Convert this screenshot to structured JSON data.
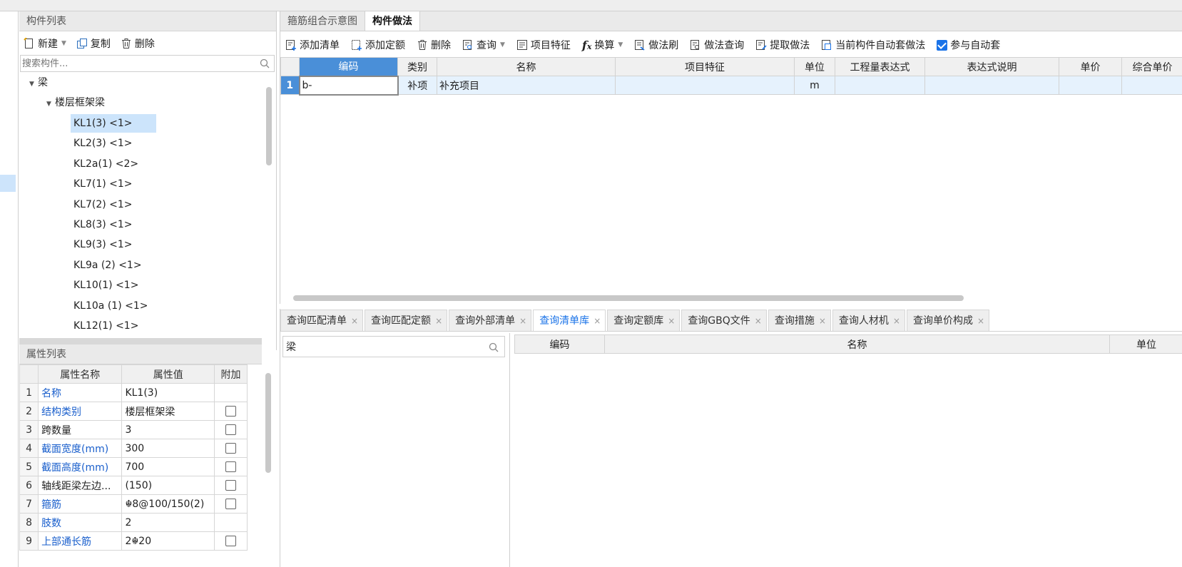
{
  "component_list": {
    "title": "构件列表",
    "toolbar": {
      "new_label": "新建",
      "copy_label": "复制",
      "delete_label": "删除"
    },
    "search_placeholder": "搜索构件...",
    "tree": {
      "root": "梁",
      "group": "楼层框架梁",
      "items": [
        "KL1(3) <1>",
        "KL2(3) <1>",
        "KL2a(1) <2>",
        "KL7(1) <1>",
        "KL7(2) <1>",
        "KL8(3) <1>",
        "KL9(3) <1>",
        "KL9a (2)  <1>",
        "KL10(1) <1>",
        "KL10a (1)  <1>",
        "KL12(1) <1>"
      ]
    }
  },
  "property_list": {
    "title": "属性列表",
    "headers": [
      "属性名称",
      "属性值",
      "附加"
    ],
    "rows": [
      {
        "idx": "1",
        "name": "名称",
        "value": "KL1(3)"
      },
      {
        "idx": "2",
        "name": "结构类别",
        "value": "楼层框架梁"
      },
      {
        "idx": "3",
        "name": "跨数量",
        "value": "3"
      },
      {
        "idx": "4",
        "name": "截面宽度(mm)",
        "value": "300"
      },
      {
        "idx": "5",
        "name": "截面高度(mm)",
        "value": "700"
      },
      {
        "idx": "6",
        "name": "轴线距梁左边...",
        "value": "(150)"
      },
      {
        "idx": "7",
        "name": "箍筋",
        "value": "☬8@100/150(2)"
      },
      {
        "idx": "8",
        "name": "肢数",
        "value": "2"
      },
      {
        "idx": "9",
        "name": "上部通长筋",
        "value": "2☬20"
      }
    ]
  },
  "top_tabs": [
    "箍筋组合示意图",
    "构件做法"
  ],
  "method_toolbar": {
    "add_list": "添加清单",
    "add_quota": "添加定额",
    "delete": "删除",
    "query": "查询",
    "item_feature": "项目特征",
    "convert": "换算",
    "method_brush": "做法刷",
    "method_query": "做法查询",
    "extract_method": "提取做法",
    "auto_apply": "当前构件自动套做法",
    "participate_auto": "参与自动套"
  },
  "method_grid": {
    "headers": [
      "编码",
      "类别",
      "名称",
      "项目特征",
      "单位",
      "工程量表达式",
      "表达式说明",
      "单价",
      "综合单价"
    ],
    "rows": [
      {
        "no": "1",
        "code": "b-",
        "category": "补项",
        "name": "补充项目",
        "feature": "",
        "unit": "m",
        "expr": "",
        "expr_desc": "",
        "price": "",
        "total_price": ""
      }
    ]
  },
  "bottom_tabs": [
    "查询匹配清单",
    "查询匹配定额",
    "查询外部清单",
    "查询清单库",
    "查询定额库",
    "查询GBQ文件",
    "查询措施",
    "查询人材机",
    "查询单价构成"
  ],
  "bottom_search": {
    "value": "梁"
  },
  "bottom_grid": {
    "headers": [
      "编码",
      "名称",
      "单位"
    ]
  },
  "colors": {
    "accent": "#1a73e8",
    "selected_row": "#cce4fb",
    "header_highlight": "#4a8fd8",
    "link_blue": "#1a5fcc"
  }
}
